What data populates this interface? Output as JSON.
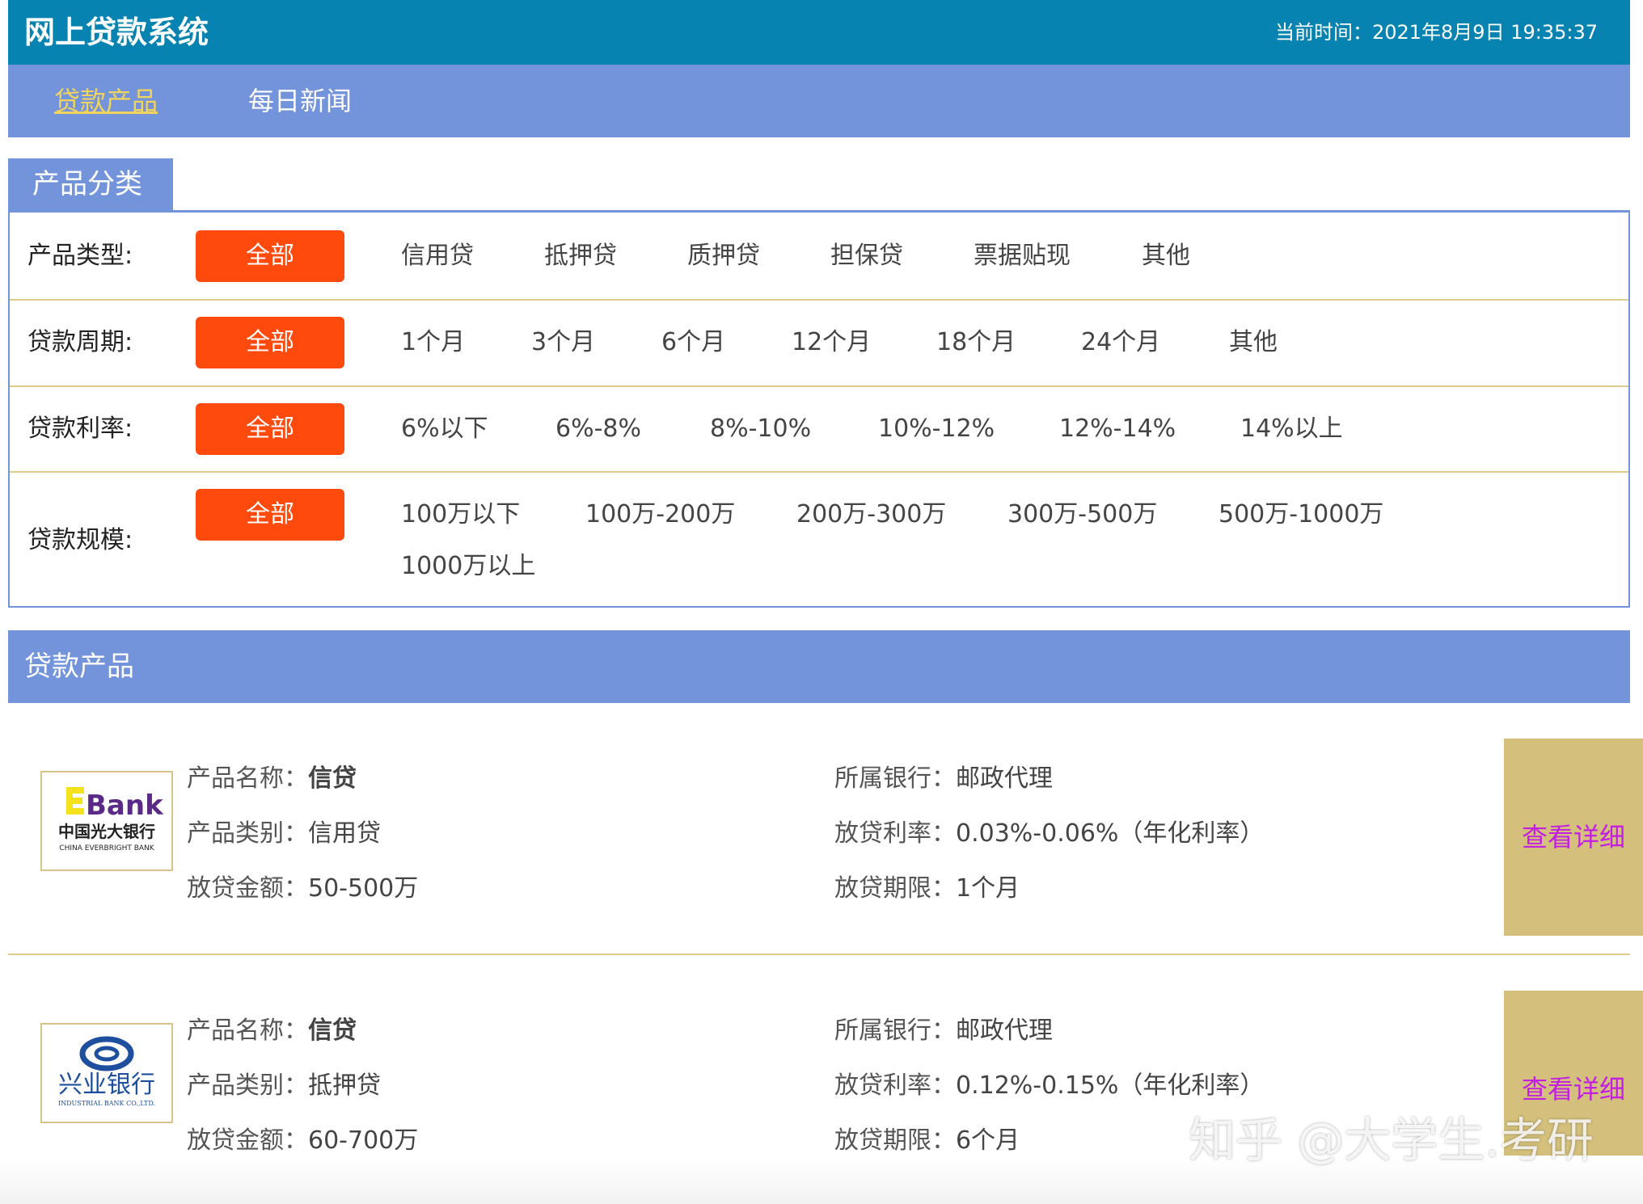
{
  "header": {
    "title": "网上贷款系统",
    "clock_label": "当前时间：",
    "clock_value": "2021年8月9日 19:35:37"
  },
  "nav": {
    "items": [
      {
        "label": "贷款产品"
      },
      {
        "label": "每日新闻"
      }
    ]
  },
  "category": {
    "tab_label": "产品分类",
    "all_label": "全部",
    "rows": [
      {
        "label": "产品类型:",
        "options": [
          "信用贷",
          "抵押贷",
          "质押贷",
          "担保贷",
          "票据贴现",
          "其他"
        ]
      },
      {
        "label": "贷款周期:",
        "options": [
          "1个月",
          "3个月",
          "6个月",
          "12个月",
          "18个月",
          "24个月",
          "其他"
        ]
      },
      {
        "label": "贷款利率:",
        "options": [
          "6%以下",
          "6%-8%",
          "8%-10%",
          "10%-12%",
          "12%-14%",
          "14%以上"
        ]
      },
      {
        "label": "贷款规模:",
        "options": [
          "100万以下",
          "100万-200万",
          "200万-300万",
          "300万-500万",
          "500万-1000万",
          "1000万以上"
        ]
      }
    ]
  },
  "products": {
    "section_title": "贷款产品",
    "field_labels": {
      "name": "产品名称：",
      "type": "产品类别：",
      "amount": "放贷金额：",
      "bank": "所属银行：",
      "rate": "放贷利率：",
      "term": "放贷期限："
    },
    "detail_label": "查看详细",
    "items": [
      {
        "logo_word": "Bank",
        "logo_cn": "中国光大银行",
        "logo_en": "CHINA EVERBRIGHT BANK",
        "name": "信贷",
        "type": "信用贷",
        "amount": "50-500万",
        "bank": "邮政代理",
        "rate": "0.03%-0.06%（年化利率）",
        "term": "1个月"
      },
      {
        "logo_cn": "兴业银行",
        "logo_en": "INDUSTRIAL BANK CO.,LTD.",
        "name": "信贷",
        "type": "抵押贷",
        "amount": "60-700万",
        "bank": "邮政代理",
        "rate": "0.12%-0.15%（年化利率）",
        "term": "6个月"
      }
    ]
  },
  "watermark": "知乎 @大学生.考研",
  "colors": {
    "header_bg": "#0683b0",
    "nav_bg": "#7393db",
    "active_nav": "#f2d45c",
    "all_button": "#ff4a0e",
    "divider": "#e0cc8a",
    "detail_bg": "#d4c07c",
    "detail_text": "#c21fe0"
  }
}
